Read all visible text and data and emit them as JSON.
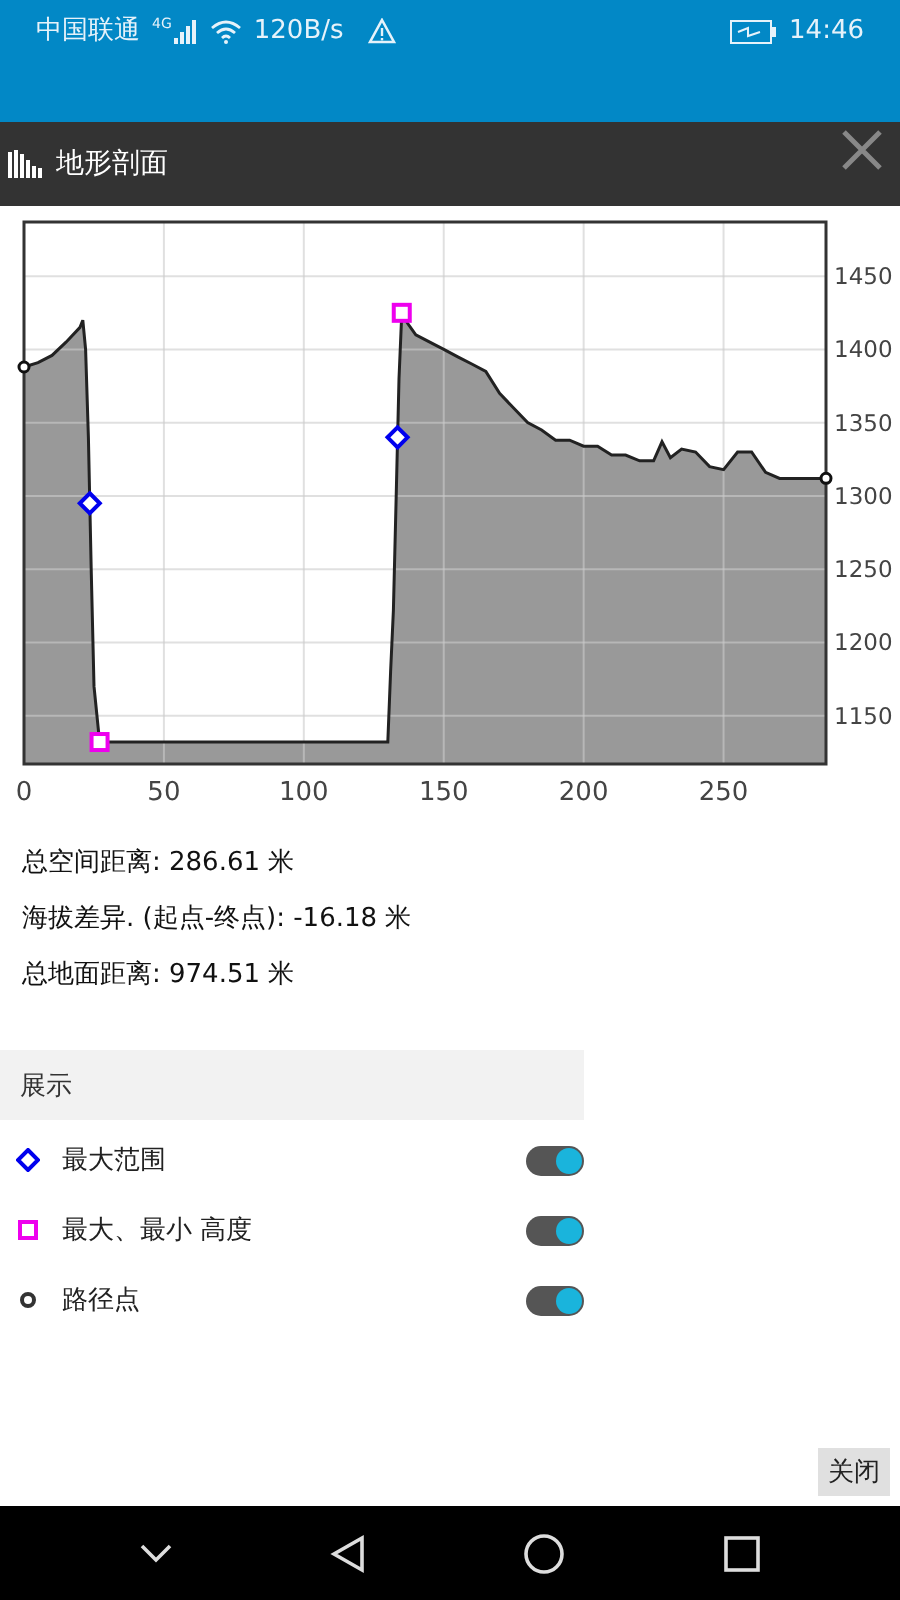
{
  "status_bar": {
    "carrier": "中国联通",
    "network": "4G",
    "speed": "120B/s",
    "time": "14:46"
  },
  "header": {
    "title": "地形剖面"
  },
  "profile": {
    "chart_data": {
      "type": "area",
      "xlim": [
        0,
        286.61
      ],
      "ylim": [
        1117,
        1487
      ],
      "xticks": [
        0,
        50,
        100,
        150,
        200,
        250
      ],
      "yticks": [
        1150,
        1200,
        1250,
        1300,
        1350,
        1400,
        1450
      ],
      "x": [
        0,
        5,
        10,
        15,
        20,
        21,
        22,
        23,
        24,
        25,
        27,
        130,
        131,
        132,
        133,
        134,
        135,
        137,
        140,
        145,
        150,
        155,
        160,
        165,
        170,
        175,
        180,
        185,
        190,
        195,
        200,
        205,
        210,
        215,
        220,
        225,
        228,
        231,
        235,
        240,
        245,
        250,
        255,
        260,
        265,
        270,
        286.61
      ],
      "grid": true,
      "series": [
        {
          "color": "#999999",
          "values": [
            1388,
            1391,
            1396,
            1405,
            1415,
            1420,
            1400,
            1340,
            1250,
            1170,
            1132,
            1132,
            1180,
            1222,
            1300,
            1380,
            1425,
            1418,
            1410,
            1405,
            1400,
            1395,
            1390,
            1385,
            1370,
            1360,
            1350,
            1345,
            1338,
            1338,
            1334,
            1334,
            1328,
            1328,
            1324,
            1324,
            1337,
            1326,
            1332,
            1330,
            1320,
            1318,
            1330,
            1330,
            1316,
            1312,
            1312
          ]
        }
      ]
    }
  },
  "stats": [
    "总空间距离: 286.61 米",
    "海拔差异. (起点-终点): -16.18 米",
    "总地面距离: 974.51 米"
  ],
  "display": {
    "heading": "展示",
    "options": [
      {
        "kind": "diamond",
        "label": "最大范围",
        "on": true
      },
      {
        "kind": "square",
        "label": "最大、最小 高度",
        "on": true
      },
      {
        "kind": "circle",
        "label": "路径点",
        "on": true
      }
    ]
  },
  "close_button": "关闭"
}
